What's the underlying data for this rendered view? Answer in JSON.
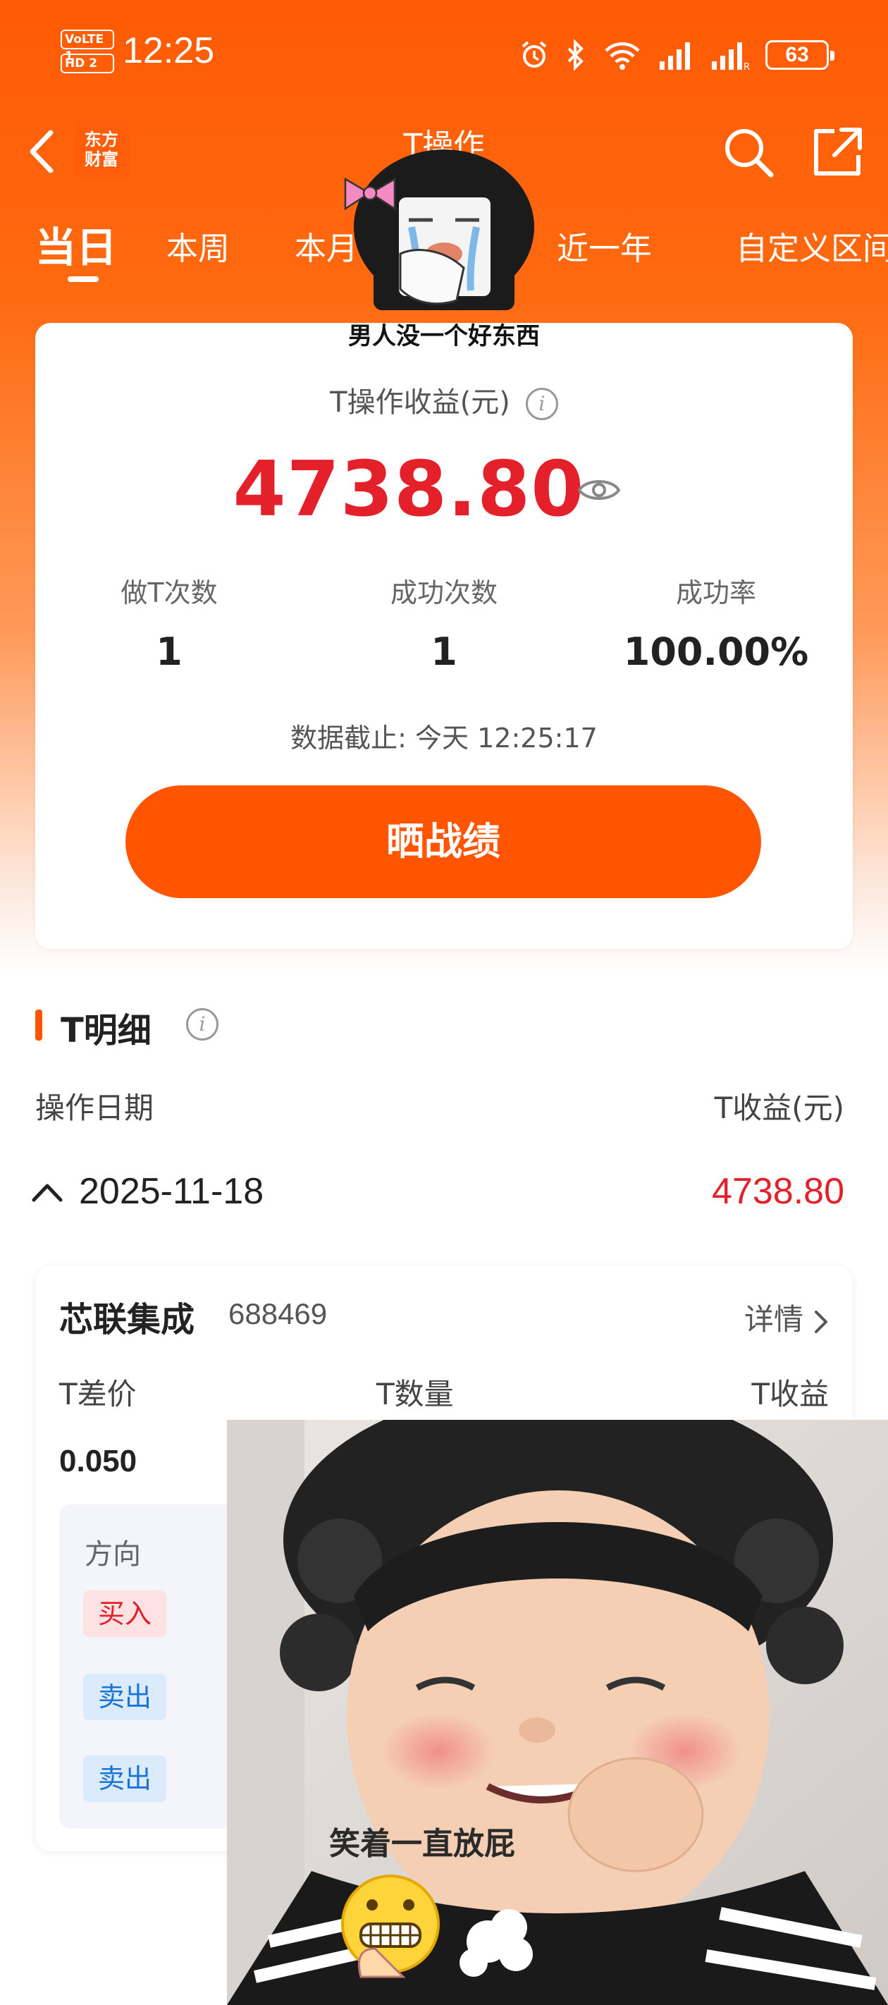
{
  "status_bar": {
    "net_top": "VoLTE 1",
    "net_bottom": "HD 2",
    "time": "12:25",
    "battery": "63"
  },
  "nav": {
    "title": "T操作",
    "logo_line1": "东方",
    "logo_line2": "财富"
  },
  "tabs": [
    "当日",
    "本周",
    "本月",
    "近一年",
    "自定义区间"
  ],
  "sticker_top": {
    "caption": "男人没一个好东西"
  },
  "summary": {
    "title": "T操作收益(元)",
    "amount": "4738.80",
    "stats": [
      {
        "label": "做T次数",
        "value": "1"
      },
      {
        "label": "成功次数",
        "value": "1"
      },
      {
        "label": "成功率",
        "value": "100.00%"
      }
    ],
    "updated": "数据截止: 今天 12:25:17",
    "share_button": "晒战绩"
  },
  "detail": {
    "section_title": "T明细",
    "col_date": "操作日期",
    "col_profit": "T收益(元)",
    "date": "2025-11-18",
    "date_profit": "4738.80",
    "stock": {
      "name": "芯联集成",
      "code": "688469",
      "detail_link": "详情",
      "headers": [
        "T差价",
        "T数量",
        "T收益"
      ],
      "spread": "0.050",
      "direction_header": "方向",
      "directions": [
        "买入",
        "卖出",
        "卖出"
      ]
    }
  },
  "sticker_bottom": {
    "caption": "笑着一直放屁"
  },
  "colors": {
    "brand_orange": "#ff5500",
    "profit_red": "#e4212b",
    "sell_blue": "#1a74d8"
  }
}
